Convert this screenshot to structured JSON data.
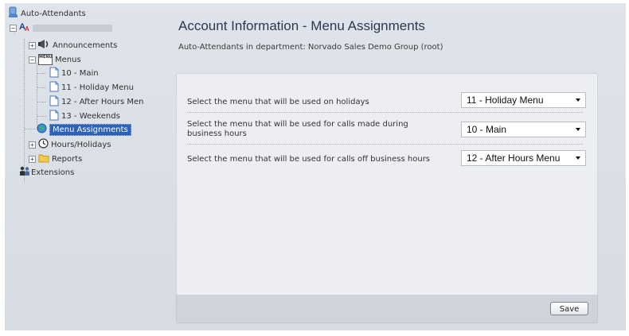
{
  "tree": {
    "root_label": "Auto-Attendants",
    "announcements_label": "Announcements",
    "menus_label": "Menus",
    "menu_items": [
      "10 - Main",
      "11 - Holiday Menu",
      "12 - After Hours Men",
      "13 - Weekends"
    ],
    "menu_assignments_label": "Menu Assignments",
    "hours_label": "Hours/Holidays",
    "reports_label": "Reports",
    "extensions_label": "Extensions",
    "menus_icon_text": "MENU"
  },
  "main": {
    "title": "Account Information - Menu Assignments",
    "department_line": "Auto-Attendants in department: Norvado Sales Demo Group (root)",
    "rows": [
      {
        "label": "Select the menu that will be used on holidays",
        "value": "11 - Holiday Menu"
      },
      {
        "label": "Select the menu that will be used for calls made during business hours",
        "value": "10 - Main"
      },
      {
        "label": "Select the menu that will be used for calls off business hours",
        "value": "12 - After Hours Menu"
      }
    ],
    "save_label": "Save"
  },
  "colors": {
    "selection": "#2f63b7",
    "title_text": "#2d3a4e",
    "panel_bg": "#eceef2"
  }
}
